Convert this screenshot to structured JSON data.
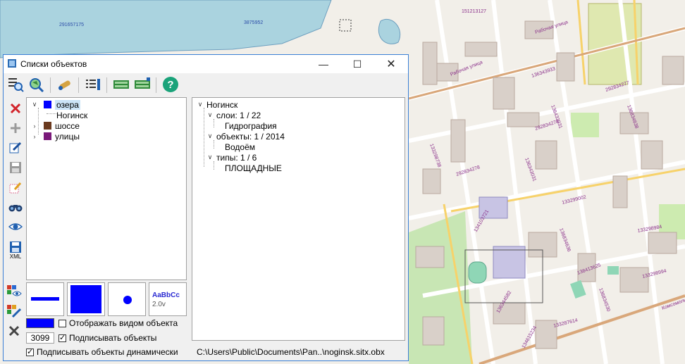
{
  "map": {
    "labels_blue": [
      "291657175",
      "3875952"
    ],
    "labels_purple": [
      "151213127",
      "Рабочая улица",
      "136343933",
      "292834277",
      "136433031",
      "292834278",
      "133298738",
      "136834638",
      "292834278",
      "136343031",
      "133299002",
      "133298984",
      "134103721",
      "138413625",
      "136834636",
      "136834530",
      "133298994",
      "133287614",
      "136344582",
      "134615234",
      "Рабочая улица",
      "Комсомольская"
    ]
  },
  "dialog": {
    "title": "Списки объектов",
    "left_tree": [
      {
        "label": "озера",
        "color": "#0000ff",
        "expanded": true,
        "selected": true,
        "children": [
          "Ногинск"
        ]
      },
      {
        "label": "шоссе",
        "color": "#6b3a1f",
        "expanded": false
      },
      {
        "label": "улицы",
        "color": "#7a1a7a",
        "expanded": false
      }
    ],
    "right_tree": {
      "root": "Ногинск",
      "groups": [
        {
          "label": "слои: 1 / 22",
          "child": "Гидрография"
        },
        {
          "label": "объекты: 1 / 2014",
          "child": "Водоём"
        },
        {
          "label": "типы: 1 / 6",
          "child": "ПЛОЩАДНЫЕ"
        }
      ]
    },
    "preview": {
      "text_sample": "AaBbCc",
      "text_size": "2.0v"
    },
    "color_value": "#0000ff",
    "count": "3099",
    "checkbox_show_as_object": {
      "label": "Отображать видом объекта",
      "checked": false
    },
    "checkbox_sign_objects": {
      "label": "Подписывать объекты",
      "checked": true
    },
    "checkbox_sign_dynamic": {
      "label": "Подписывать объекты динамически",
      "checked": true
    },
    "file_path": "C:\\Users\\Public\\Documents\\Pan..\\noginsk.sitx.obx",
    "xml_label": "XML"
  }
}
